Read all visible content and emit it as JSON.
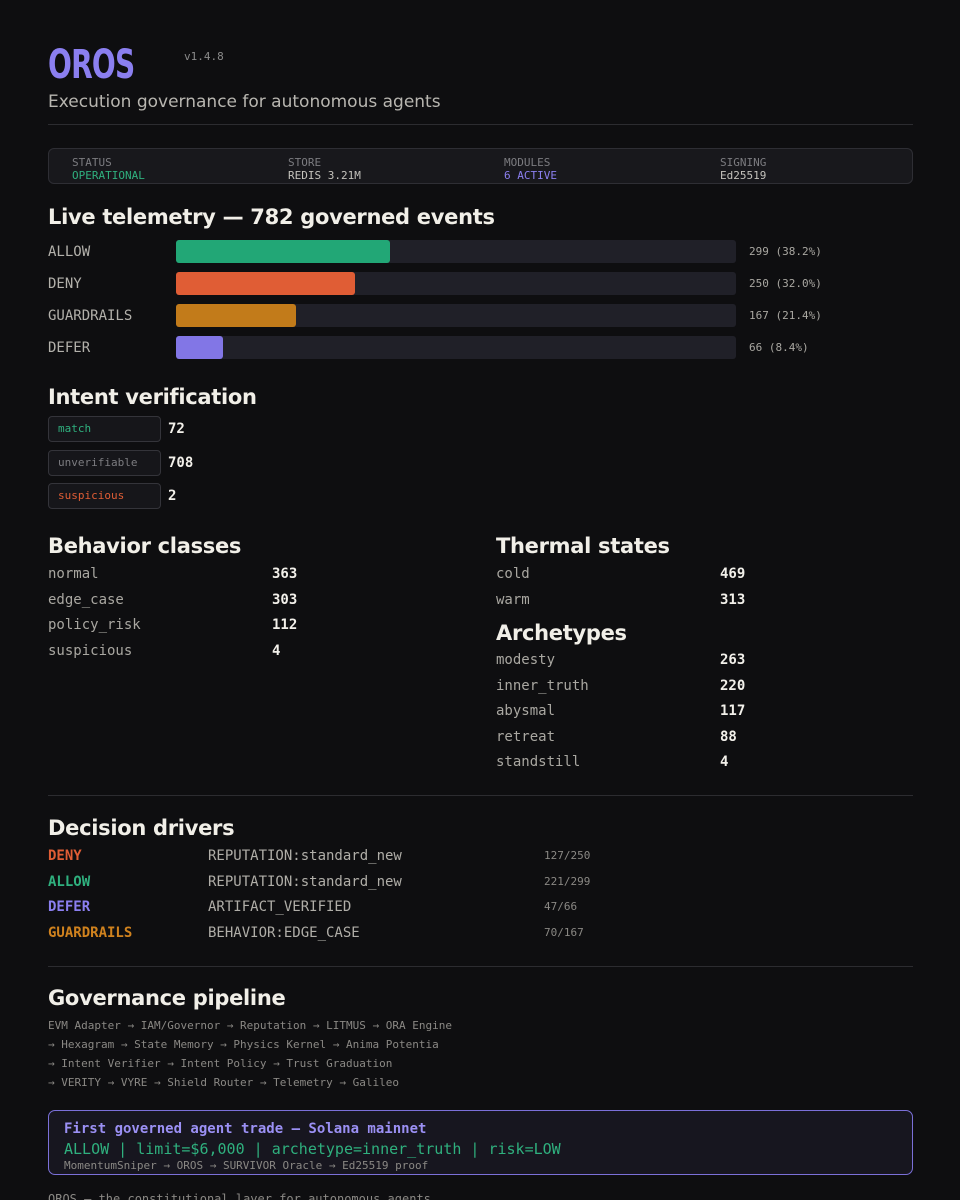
{
  "header": {
    "logo": "OROS",
    "version": "v1.4.8",
    "tagline": "Execution governance for autonomous agents"
  },
  "status": [
    {
      "key": "STATUS",
      "value": "OPERATIONAL",
      "color": "#2fb07e"
    },
    {
      "key": "STORE",
      "value": "REDIS 3.21M",
      "color": "#c4c2bc"
    },
    {
      "key": "MODULES",
      "value": "6 ACTIVE",
      "color": "#8b7ff0"
    },
    {
      "key": "SIGNING",
      "value": "Ed25519",
      "color": "#c4c2bc"
    }
  ],
  "telemetry": {
    "title": "Live telemetry — 782 governed events",
    "rows": [
      {
        "label": "ALLOW",
        "value": "299 (38.2%)",
        "fraction": 0.382,
        "color": "#22a776"
      },
      {
        "label": "DENY",
        "value": "250 (32.0%)",
        "fraction": 0.32,
        "color": "#e05d35"
      },
      {
        "label": "GUARDRAILS",
        "value": "167 (21.4%)",
        "fraction": 0.214,
        "color": "#c27b1a"
      },
      {
        "label": "DEFER",
        "value": "66 (8.4%)",
        "fraction": 0.084,
        "color": "#8276e6"
      }
    ]
  },
  "intent": {
    "title": "Intent verification",
    "items": [
      {
        "label": "match",
        "count": "72",
        "color": "#2fb07e"
      },
      {
        "label": "unverifiable",
        "count": "708",
        "color": "#7c7c80"
      },
      {
        "label": "suspicious",
        "count": "2",
        "color": "#e05d35"
      }
    ]
  },
  "behavior": {
    "title": "Behavior classes",
    "items": [
      {
        "label": "normal",
        "value": "363"
      },
      {
        "label": "edge_case",
        "value": "303"
      },
      {
        "label": "policy_risk",
        "value": "112"
      },
      {
        "label": "suspicious",
        "value": "4"
      }
    ]
  },
  "thermal": {
    "title": "Thermal states",
    "items": [
      {
        "label": "cold",
        "value": "469"
      },
      {
        "label": "warm",
        "value": "313"
      }
    ]
  },
  "archetypes": {
    "title": "Archetypes",
    "items": [
      {
        "label": "modesty",
        "value": "263"
      },
      {
        "label": "inner_truth",
        "value": "220"
      },
      {
        "label": "abysmal",
        "value": "117"
      },
      {
        "label": "retreat",
        "value": "88"
      },
      {
        "label": "standstill",
        "value": "4"
      }
    ]
  },
  "drivers": {
    "title": "Decision drivers",
    "items": [
      {
        "decision": "DENY",
        "reason": "REPUTATION:standard_new",
        "count": "127/250",
        "color": "#e05d35"
      },
      {
        "decision": "ALLOW",
        "reason": "REPUTATION:standard_new",
        "count": "221/299",
        "color": "#2fb07e"
      },
      {
        "decision": "DEFER",
        "reason": "ARTIFACT_VERIFIED",
        "count": "47/66",
        "color": "#8b7ff0"
      },
      {
        "decision": "GUARDRAILS",
        "reason": "BEHAVIOR:EDGE_CASE",
        "count": "70/167",
        "color": "#d0821e"
      }
    ]
  },
  "pipeline": {
    "title": "Governance pipeline",
    "lines": [
      "EVM Adapter → IAM/Governor → Reputation → LITMUS → ORA Engine",
      "→ Hexagram → State Memory → Physics Kernel → Anima Potentia",
      "→ Intent Verifier → Intent Policy → Trust Graduation",
      "→ VERITY → VYRE → Shield Router → Telemetry → Galileo"
    ]
  },
  "callout": {
    "title": "First governed agent trade — Solana mainnet",
    "summary": "ALLOW | limit=$6,000 | archetype=inner_truth | risk=LOW",
    "path": "MomentumSniper → OROS → SURVIVOR Oracle → Ed25519 proof"
  },
  "footer": "OROS — the constitutional layer for autonomous agents"
}
